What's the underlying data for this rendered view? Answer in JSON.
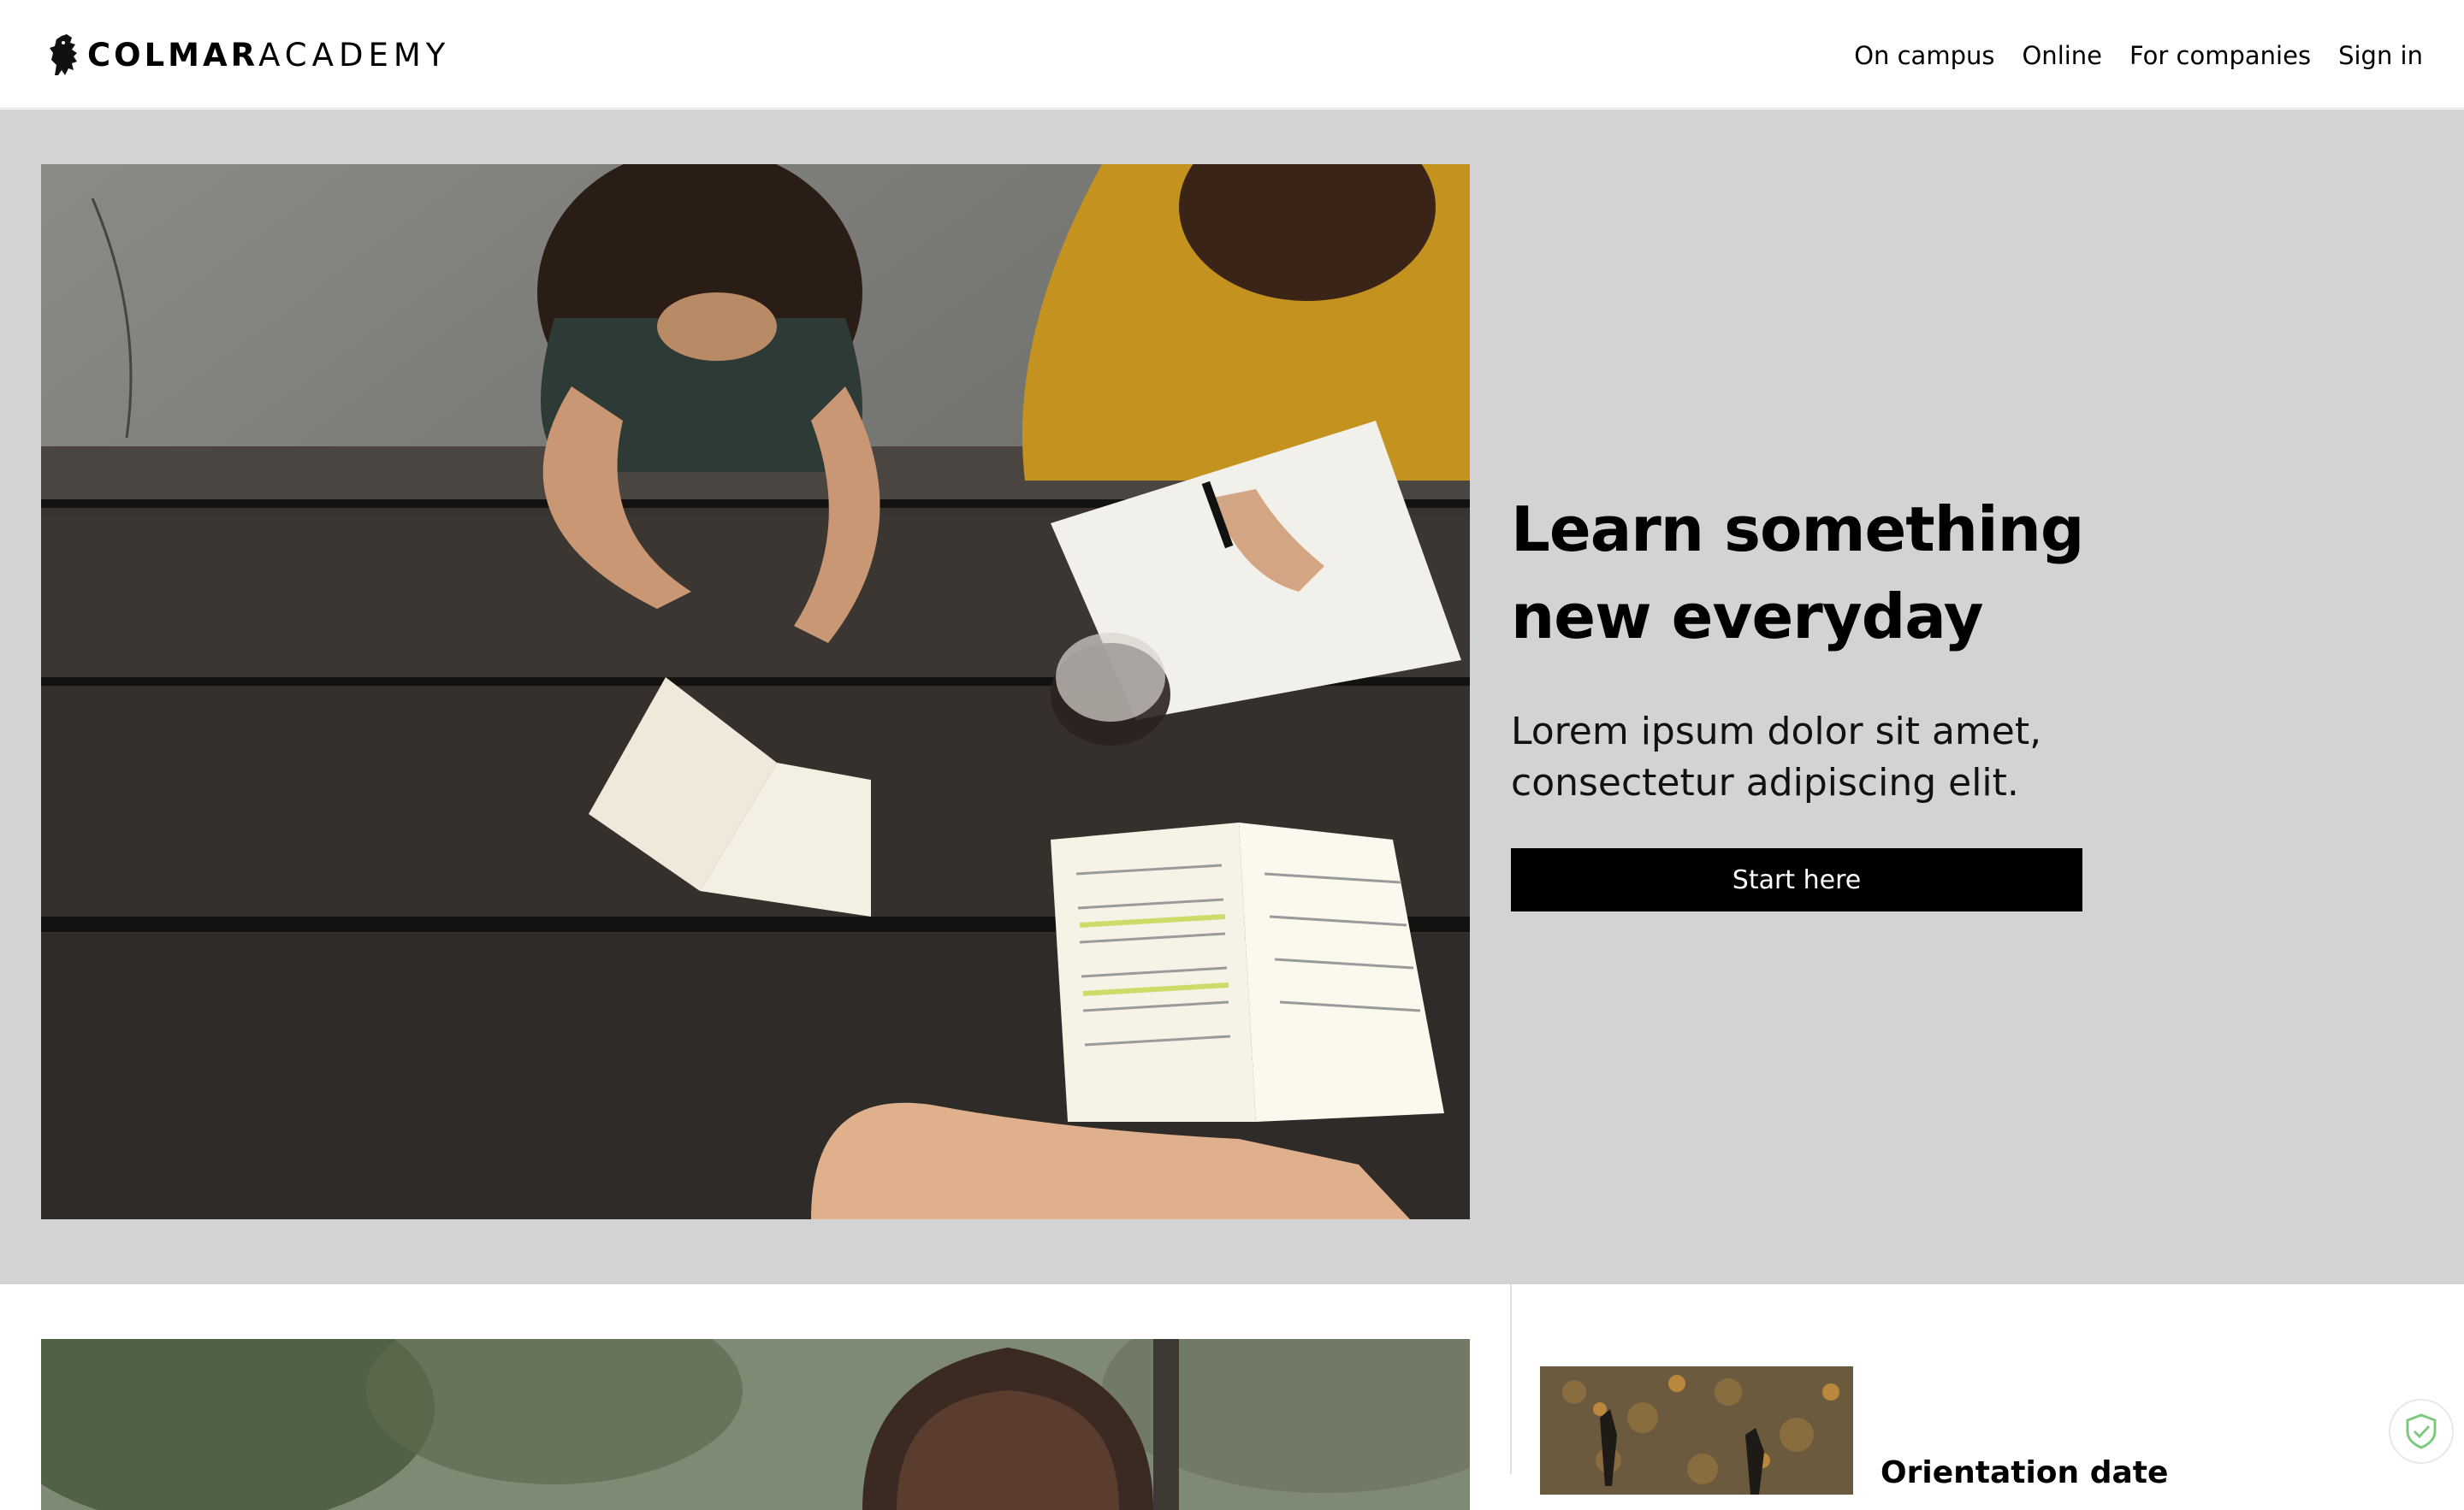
{
  "header": {
    "logo": {
      "bold": "COLMAR",
      "light": "ACADEMY",
      "icon": "lion-rampant-icon"
    },
    "nav": [
      {
        "label": "On campus"
      },
      {
        "label": "Online"
      },
      {
        "label": "For companies"
      },
      {
        "label": "Sign in"
      }
    ]
  },
  "hero": {
    "title_line1": "Learn something",
    "title_line2": "new everyday",
    "subtitle_line1": "Lorem ipsum dolor sit amet,",
    "subtitle_line2": "consectetur adipiscing elit.",
    "cta_label": "Start here",
    "background_color": "#d3d3d3"
  },
  "lower": {
    "card_title": "Orientation date"
  },
  "colors": {
    "button_bg": "#000000",
    "button_text": "#ffffff",
    "shield_accent": "#7fc97f"
  }
}
